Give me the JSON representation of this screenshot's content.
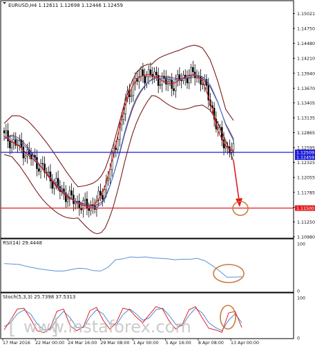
{
  "colors": {
    "background": "#ffffff",
    "candle": "#000000",
    "bollinger": "#7a1a1a",
    "ma_fast": "#d81e1e",
    "ma_slow": "#3a6fd8",
    "hline_blue": "#1b1bd6",
    "hline_red": "#e21b1b",
    "rsi": "#5b8fd9",
    "stoch_main": "#e02020",
    "stoch_signal": "#4a8ad6",
    "annotation": "#c87a3a",
    "arrow": "#e21b1b",
    "axis_text": "#111111",
    "watermark": "#c3c3c3"
  },
  "chart_data": [
    {
      "type": "line",
      "panel": "price",
      "title": "EURUSD,H4  1.12611 1.12698 1.12446 1.12459",
      "x": [
        "17 Mar 2016",
        "22 Mar 00:00",
        "24 Mar 16:00",
        "29 Mar 08:00",
        "1 Apr 00:00",
        "5 Apr 16:00",
        "8 Apr 08:00",
        "13 Apr 00:00"
      ],
      "ylim": [
        1.1098,
        1.15115
      ],
      "y_ticks": [
        "1.15021",
        "1.14750",
        "1.14480",
        "1.14210",
        "1.13940",
        "1.13670",
        "1.13405",
        "1.13135",
        "1.12865",
        "1.12595",
        "1.12325",
        "1.12055",
        "1.11785",
        "1.11515",
        "1.11250",
        "1.10980"
      ],
      "markers": [
        {
          "label": "1.12509",
          "value": 1.12509,
          "color": "#1b1bd6"
        },
        {
          "label": "1.12459",
          "value": 1.12459,
          "color": "#1b1bd6"
        },
        {
          "label": "1.11500",
          "value": 1.115,
          "color": "#e21b1b"
        }
      ],
      "series": [
        {
          "values": [
            1.128,
            1.127,
            1.1262,
            1.1248,
            1.1236,
            1.1222,
            1.1205,
            1.1188,
            1.1175,
            1.1164,
            1.1156,
            1.1152,
            1.1158,
            1.118,
            1.1228,
            1.129,
            1.1346,
            1.1378,
            1.139,
            1.1392,
            1.1386,
            1.1378,
            1.1374,
            1.1382,
            1.139,
            1.1392,
            1.138,
            1.134,
            1.1288,
            1.1262,
            1.1252
          ]
        },
        {
          "values": [
            1.1275,
            1.128,
            1.1272,
            1.1258,
            1.124,
            1.1222,
            1.1206,
            1.119,
            1.1176,
            1.1165,
            1.1158,
            1.1152,
            1.115,
            1.116,
            1.1195,
            1.1245,
            1.13,
            1.1342,
            1.1366,
            1.138,
            1.1386,
            1.1384,
            1.1382,
            1.1382,
            1.1386,
            1.139,
            1.1388,
            1.1372,
            1.134,
            1.13,
            1.1272
          ]
        }
      ]
    },
    {
      "type": "line",
      "panel": "rsi",
      "title": "RSI(14) 29.4448",
      "ylim": [
        0,
        100
      ],
      "series": [
        {
          "values": [
            58,
            57,
            56,
            52,
            49,
            46,
            44,
            42,
            42,
            45,
            48,
            47,
            43,
            42,
            50,
            66,
            68,
            72,
            71,
            72,
            70,
            69,
            68,
            66,
            67,
            67,
            69,
            64,
            54,
            42,
            29,
            29,
            30
          ]
        }
      ]
    },
    {
      "type": "line",
      "panel": "stochastic",
      "title": "Stoch(5,3,3) 25.7398 37.5313",
      "ylim": [
        0,
        100
      ],
      "series": [
        {
          "values": [
            20,
            45,
            72,
            74,
            48,
            18,
            13,
            25,
            66,
            72,
            30,
            18,
            28,
            68,
            76,
            44,
            22,
            38,
            74,
            70,
            52,
            38,
            58,
            78,
            72,
            42,
            22,
            34,
            70,
            78,
            50,
            24,
            20,
            14,
            62,
            66,
            26
          ]
        },
        {
          "values": [
            28,
            38,
            60,
            70,
            60,
            35,
            20,
            20,
            48,
            66,
            50,
            26,
            26,
            52,
            70,
            60,
            36,
            32,
            58,
            72,
            60,
            44,
            50,
            70,
            74,
            56,
            34,
            30,
            56,
            74,
            62,
            38,
            26,
            18,
            44,
            60,
            38
          ]
        }
      ]
    }
  ],
  "watermark": {
    "text": "www.instaforex.com",
    "brackets": "[   ]"
  }
}
